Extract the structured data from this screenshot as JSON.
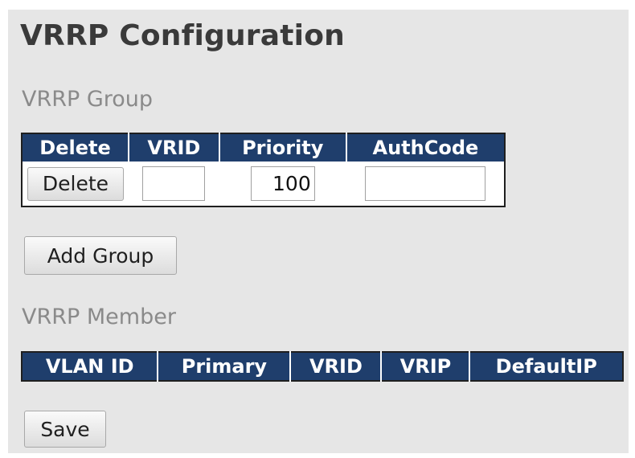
{
  "page_title": "VRRP Configuration",
  "group_section": {
    "title": "VRRP Group",
    "columns": [
      "Delete",
      "VRID",
      "Priority",
      "AuthCode"
    ],
    "rows": [
      {
        "delete_label": "Delete",
        "vrid": "",
        "priority": "100",
        "authcode": ""
      }
    ],
    "add_button_label": "Add Group"
  },
  "member_section": {
    "title": "VRRP Member",
    "columns": [
      "VLAN ID",
      "Primary",
      "VRID",
      "VRIP",
      "DefaultIP"
    ]
  },
  "save_label": "Save",
  "colors": {
    "header_bg": "#1f3e6c",
    "header_text": "#ffffff",
    "panel_bg": "#e6e6e6",
    "section_title": "#8a8a8a"
  }
}
